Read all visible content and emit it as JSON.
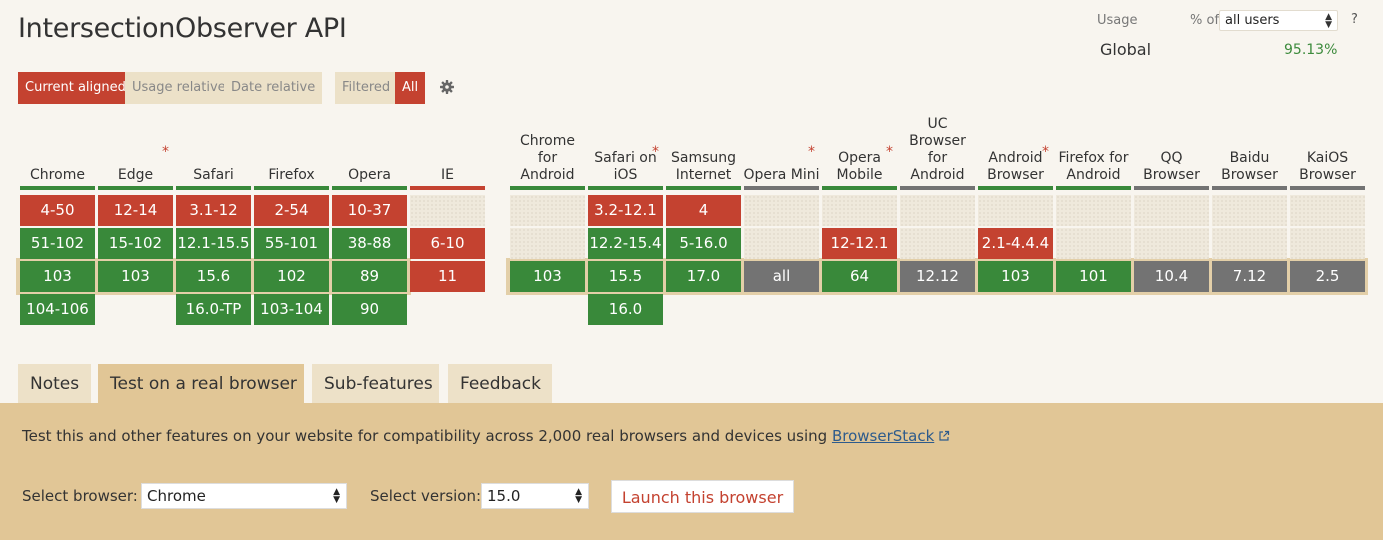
{
  "title": "IntersectionObserver API",
  "usage": {
    "label": "Usage",
    "pct_of": "% of",
    "selected": "all users",
    "help": "?",
    "global_label": "Global",
    "global_value": "95.13%"
  },
  "toolbar": {
    "current_aligned": "Current aligned",
    "usage_relative": "Usage relative",
    "date_relative": "Date relative",
    "filtered": "Filtered",
    "all": "All"
  },
  "browsers": [
    {
      "name": [
        "Chrome"
      ],
      "star": false
    },
    {
      "name": [
        "Edge"
      ],
      "star": true
    },
    {
      "name": [
        "Safari"
      ],
      "star": false
    },
    {
      "name": [
        "Firefox"
      ],
      "star": false
    },
    {
      "name": [
        "Opera"
      ],
      "star": false
    },
    {
      "name": [
        "IE"
      ],
      "star": false
    },
    {
      "name": [
        "Chrome",
        "for",
        "Android"
      ],
      "star": false
    },
    {
      "name": [
        "Safari on",
        "iOS"
      ],
      "star": true
    },
    {
      "name": [
        "Samsung",
        "Internet"
      ],
      "star": false
    },
    {
      "name": [
        "Opera Mini"
      ],
      "star": true
    },
    {
      "name": [
        "Opera",
        "Mobile"
      ],
      "star": true
    },
    {
      "name": [
        "UC",
        "Browser",
        "for",
        "Android"
      ],
      "star": false
    },
    {
      "name": [
        "Android",
        "Browser"
      ],
      "star": true
    },
    {
      "name": [
        "Firefox for",
        "Android"
      ],
      "star": false
    },
    {
      "name": [
        "QQ",
        "Browser"
      ],
      "star": false
    },
    {
      "name": [
        "Baidu",
        "Browser"
      ],
      "star": false
    },
    {
      "name": [
        "KaiOS",
        "Browser"
      ],
      "star": false
    }
  ],
  "support": [
    [
      [
        "4-50",
        "n"
      ],
      [
        "51-102",
        "y"
      ],
      [
        "103",
        "y"
      ],
      [
        "104-106",
        "y"
      ]
    ],
    [
      [
        "12-14",
        "n"
      ],
      [
        "15-102",
        "y"
      ],
      [
        "103",
        "y"
      ],
      [
        "",
        ""
      ]
    ],
    [
      [
        "3.1-12",
        "n"
      ],
      [
        "12.1-15.5",
        "y"
      ],
      [
        "15.6",
        "y"
      ],
      [
        "16.0-TP",
        "y"
      ]
    ],
    [
      [
        "2-54",
        "n"
      ],
      [
        "55-101",
        "y"
      ],
      [
        "102",
        "y"
      ],
      [
        "103-104",
        "y"
      ]
    ],
    [
      [
        "10-37",
        "n"
      ],
      [
        "38-88",
        "y"
      ],
      [
        "89",
        "y"
      ],
      [
        "90",
        "y"
      ]
    ],
    [
      [
        "",
        "e"
      ],
      [
        "6-10",
        "n"
      ],
      [
        "11",
        "n"
      ],
      [
        "",
        ""
      ]
    ],
    [
      [
        "",
        "e"
      ],
      [
        "",
        "e"
      ],
      [
        "103",
        "y"
      ],
      [
        "",
        ""
      ]
    ],
    [
      [
        "3.2-12.1",
        "n"
      ],
      [
        "12.2-15.4",
        "y"
      ],
      [
        "15.5",
        "y"
      ],
      [
        "16.0",
        "y"
      ]
    ],
    [
      [
        "4",
        "n"
      ],
      [
        "5-16.0",
        "y"
      ],
      [
        "17.0",
        "y"
      ],
      [
        "",
        ""
      ]
    ],
    [
      [
        "",
        "e"
      ],
      [
        "",
        "e"
      ],
      [
        "all",
        "u"
      ],
      [
        "",
        ""
      ]
    ],
    [
      [
        "",
        "e"
      ],
      [
        "12-12.1",
        "n"
      ],
      [
        "64",
        "y"
      ],
      [
        "",
        ""
      ]
    ],
    [
      [
        "",
        "e"
      ],
      [
        "",
        "e"
      ],
      [
        "12.12",
        "u"
      ],
      [
        "",
        ""
      ]
    ],
    [
      [
        "",
        "e"
      ],
      [
        "2.1-4.4.4",
        "n"
      ],
      [
        "103",
        "y"
      ],
      [
        "",
        ""
      ]
    ],
    [
      [
        "",
        "e"
      ],
      [
        "",
        "e"
      ],
      [
        "101",
        "y"
      ],
      [
        "",
        ""
      ]
    ],
    [
      [
        "",
        "e"
      ],
      [
        "",
        "e"
      ],
      [
        "10.4",
        "u"
      ],
      [
        "",
        ""
      ]
    ],
    [
      [
        "",
        "e"
      ],
      [
        "",
        "e"
      ],
      [
        "7.12",
        "u"
      ],
      [
        "",
        ""
      ]
    ],
    [
      [
        "",
        "e"
      ],
      [
        "",
        "e"
      ],
      [
        "2.5",
        "u"
      ],
      [
        "",
        ""
      ]
    ]
  ],
  "tabs": [
    "Notes",
    "Test on a real browser",
    "Sub-features",
    "Feedback"
  ],
  "panel": {
    "description": "Test this and other features on your website for compatibility across 2,000 real browsers and devices using ",
    "link": "BrowserStack",
    "select_browser_label": "Select browser:",
    "browser_value": "Chrome",
    "select_version_label": "Select version:",
    "version_value": "15.0",
    "launch": "Launch this browser"
  },
  "colors": {
    "supported": "#39893a",
    "unsupported": "#c44230",
    "unknown": "#737373",
    "accent": "#c44230"
  }
}
